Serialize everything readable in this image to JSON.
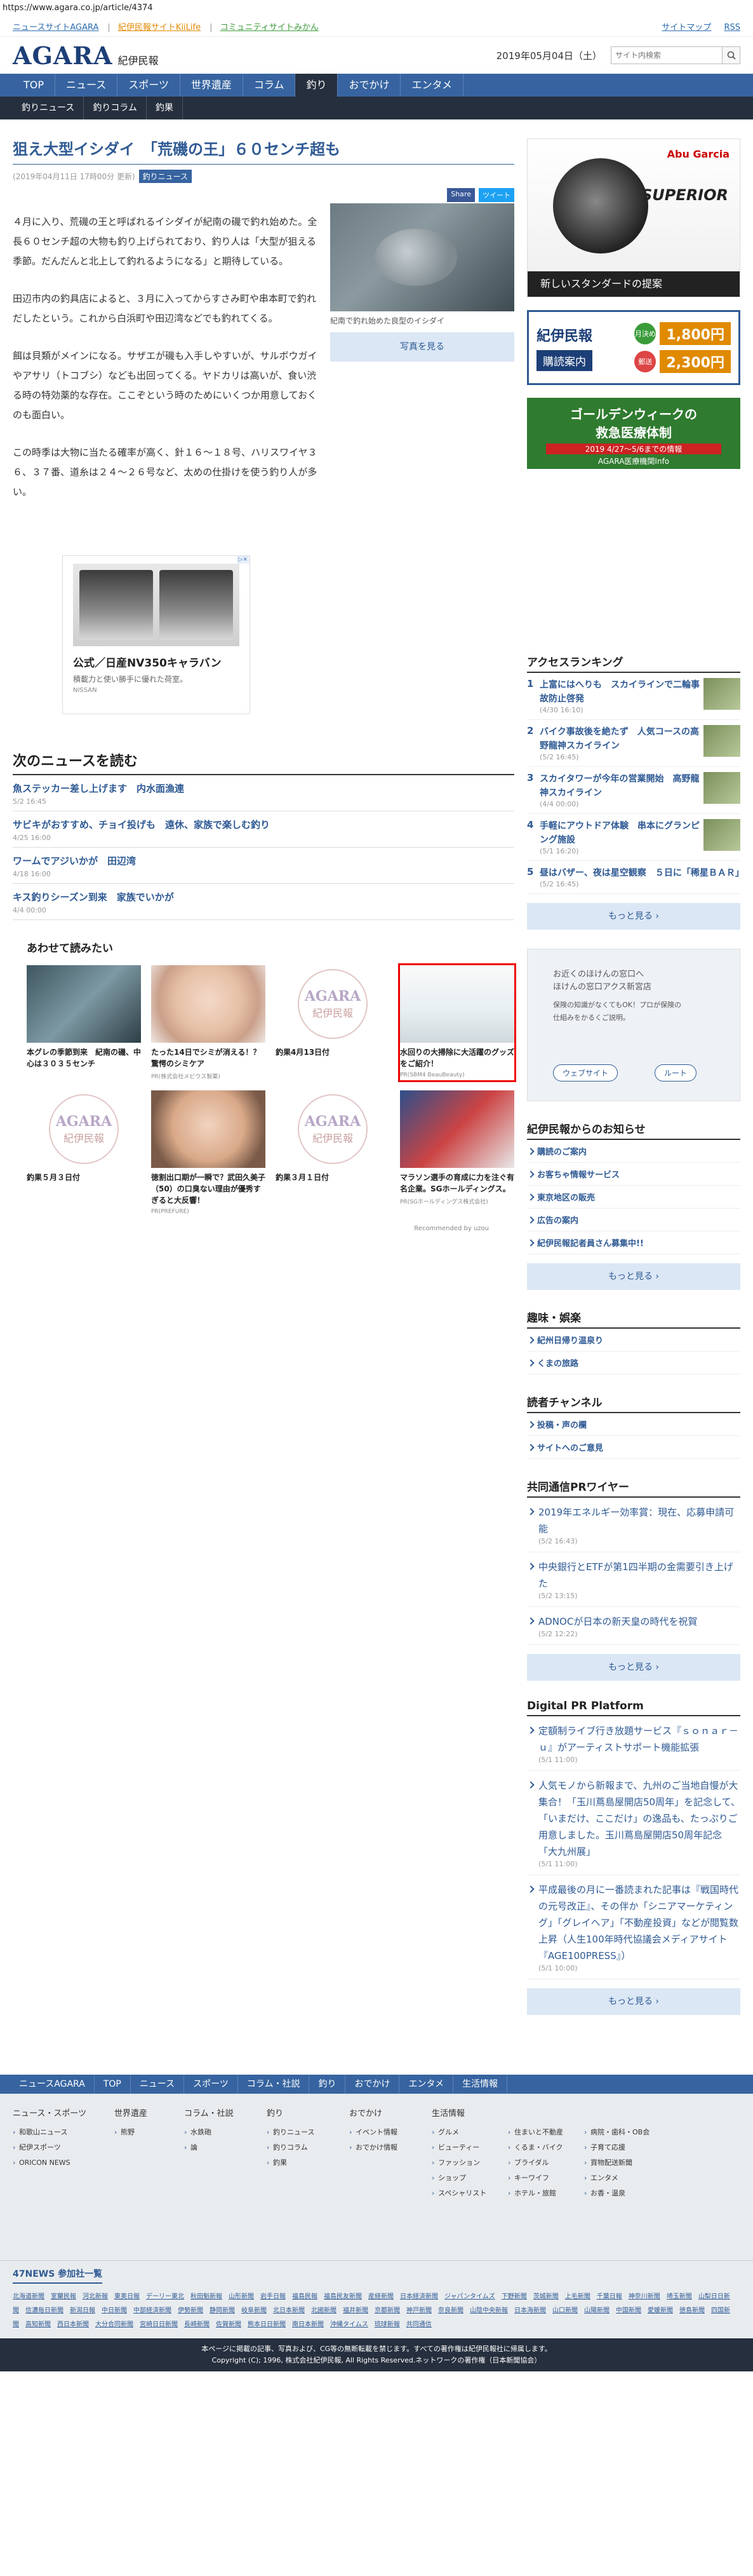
{
  "url": "https://www.agara.co.jp/article/4374",
  "toplinks": {
    "left": [
      "ニュースサイトAGARA",
      "紀伊民報サイトKiiLife",
      "コミュニティサイトみかん"
    ],
    "right": [
      "サイトマップ",
      "RSS"
    ]
  },
  "header": {
    "logo_en": "AGARA",
    "logo_jp": "紀伊民報",
    "date": "2019年05月04日（土）",
    "search_placeholder": "サイト内検索"
  },
  "nav": [
    "TOP",
    "ニュース",
    "スポーツ",
    "世界遺産",
    "コラム",
    "釣り",
    "おでかけ",
    "エンタメ"
  ],
  "nav_active": "釣り",
  "subnav": [
    "釣りニュース",
    "釣りコラム",
    "釣果"
  ],
  "article": {
    "title": "狙え大型イシダイ　「荒磯の王」６０センチ超も",
    "date": "2019年04月11日 17時00分",
    "updated": "更新",
    "category": "釣りニュース",
    "share_fb": "Share",
    "share_tw": "ツイート",
    "paragraphs": [
      "４月に入り、荒磯の王と呼ばれるイシダイが紀南の磯で釣れ始めた。全長６０センチ超の大物も釣り上げられており、釣り人は「大型が狙える季節。だんだんと北上して釣れるようになる」と期待している。",
      "田辺市内の釣具店によると、３月に入ってからすさみ町や串本町で釣れだしたという。これから白浜町や田辺湾などでも釣れてくる。",
      "餌は貝類がメインになる。サザエが磯も入手しやすいが、サルボウガイやアサリ（トコブシ）なども出回ってくる。ヤドカリは高いが、食い渋る時の特効薬的な存在。ここぞという時のためにいくつか用意しておくのも面白い。",
      "この時季は大物に当たる確率が高く、針１６～１８号、ハリスワイヤ３６、３７番、道糸は２４～２６号など、太めの仕掛けを使う釣り人が多い。"
    ],
    "photo_caption": "紀南で釣れ始めた良型のイシダイ",
    "photo_button": "写真を見る"
  },
  "ad": {
    "title": "公式／日産NV350キャラバン",
    "sub": "積載力と使い勝手に優れた荷室。",
    "brand": "NISSAN"
  },
  "next_news": {
    "heading": "次のニュースを読む",
    "items": [
      {
        "title": "魚ステッカー差し上げます　内水面漁連",
        "date": "5/2 16:45"
      },
      {
        "title": "サビキがおすすめ、チョイ投げも　遠休、家族で楽しむ釣り",
        "date": "4/25 16:00"
      },
      {
        "title": "ワームでアジいかが　田辺湾",
        "date": "4/18 16:00"
      },
      {
        "title": "キス釣りシーズン到来　家族でいかが",
        "date": "4/4 00:00"
      }
    ]
  },
  "recommended": {
    "heading": "あわせて読みたい",
    "items": [
      {
        "title": "本グレの季節到来　紀南の磯、中心は３０３５センチ",
        "source": ""
      },
      {
        "title": "たった14日でシミが消える！？驚愕のシミケア",
        "source": "PR(株式会社メビウス製薬)"
      },
      {
        "title": "釣果4月13日付",
        "source": ""
      },
      {
        "title": "水回りの大掃除に大活躍のグッズをご紹介！",
        "source": "PR(SBM4 BeauBeauty)"
      },
      {
        "title": "釣果５月３日付",
        "source": ""
      },
      {
        "title": "徳割出口期が一瞬で？武田久美子（50）の口臭ない理由が優秀すぎると大反響！",
        "source": "PR(PREFURE)"
      },
      {
        "title": "釣果３月１日付",
        "source": ""
      },
      {
        "title": "マラソン選手の育成に力を注ぐ有名企業。SGホールディングス。",
        "source": "PR(SGホールディングス株式会社)"
      }
    ],
    "recommended_by": "Recommended by uzou"
  },
  "sidebar": {
    "reel_brand": "Abu Garcia",
    "reel_name": "SUPERIOR",
    "reel_sub": "新しいスタンダードの提案",
    "subs_title": "紀伊民報",
    "subs_btn": "購読案内",
    "subs_price1_tag": "月決め",
    "subs_price1": "1,800円",
    "subs_price2_tag": "郵送",
    "subs_price2": "2,300円",
    "gw_line1": "ゴールデンウィークの",
    "gw_line2": "救急医療体制",
    "gw_line3": "2019 4/27～5/6までの情報",
    "gw_line4": "AGARA医療機関Info",
    "ranking_heading": "アクセスランキング",
    "ranking": [
      {
        "title": "上富にはへりも　スカイラインで二輪事故防止啓発",
        "date": "(4/30 16:10)"
      },
      {
        "title": "バイク事故後を絶たず　人気コースの高野龍神スカイライン",
        "date": "(5/2 16:45)"
      },
      {
        "title": "スカイタワーが今年の営業開始　高野龍神スカイライン",
        "date": "(4/4 00:00)"
      },
      {
        "title": "手軽にアウトドア体験　串本にグランピング施設",
        "date": "(5/1 16:20)"
      },
      {
        "title": "昼はバザー、夜は星空観察　５日に「稀星ＢＡＲ」",
        "date": "(5/2 16:45)"
      }
    ],
    "more": "もっと見る ›",
    "map_text1": "お近くのほけんの窓口へ",
    "map_text2": "ほけんの窓口アクス新宮店",
    "map_text3": "保険の知識がなくてもOK！プロが保険の",
    "map_text4": "仕組みをかるくご説明。",
    "map_btn1": "ウェブサイト",
    "map_btn2": "ルート",
    "notice_heading": "紀伊民報からのお知らせ",
    "notices": [
      "購読のご案内",
      "お客ちゃ情報サービス",
      "東京地区の販売",
      "広告の案内",
      "紀伊民報記者員さん募集中!!"
    ],
    "hobby_heading": "趣味・娯楽",
    "hobbies": [
      "紀州日帰り温泉り",
      "くまの旅路"
    ],
    "reader_heading": "読者チャンネル",
    "readers": [
      "投稿・声の欄",
      "サイトへのご意見"
    ],
    "kyodo_heading": "共同通信PRワイヤー",
    "kyodo": [
      {
        "title": "2019年エネルギー効率賞：現在、応募申請可能",
        "date": "(5/2 16:43)"
      },
      {
        "title": "中央銀行とETFが第1四半期の金需要引き上げた",
        "date": "(5/2 13:15)"
      },
      {
        "title": "ADNOCが日本の新天皇の時代を祝賀",
        "date": "(5/2 12:22)"
      }
    ],
    "digital_heading": "Digital PR Platform",
    "digital": [
      {
        "title": "定額制ライブ行き放題サービス『ｓｏｎａｒ－ｕ』がアーティストサポート機能拡張",
        "date": "(5/1 11:00)"
      },
      {
        "title": "人気モノから新報まで、九州のご当地自慢が大集合！「玉川蔦島屋開店50周年」を記念して、「いまだけ、ここだけ」の逸品も、たっぷりご用意しました。玉川蔦島屋開店50周年記念「大九州展」",
        "date": "(5/1 11:00)"
      },
      {
        "title": "平成最後の月に一番読まれた記事は『戦国時代の元号改正』、その伴か「シニアマーケティング」「グレイヘア」「不動産投資」などが閲覧数上昇（人生100年時代協議会メディアサイト『AGE100PRESS』）",
        "date": "(5/1 10:00)"
      }
    ]
  },
  "footer": {
    "nav": [
      "ニュースAGARA",
      "TOP",
      "ニュース",
      "スポーツ",
      "コラム・社説",
      "釣り",
      "おでかけ",
      "エンタメ",
      "生活情報"
    ],
    "cols": [
      {
        "h": "ニュース・スポーツ",
        "items": [
          "和歌山ニュース",
          "紀伊スポーツ",
          "ORICON NEWS"
        ]
      },
      {
        "h": "世界遺産",
        "items": [
          "熊野"
        ]
      },
      {
        "h": "コラム・社説",
        "items": [
          "水鉄砲",
          "論"
        ]
      },
      {
        "h": "釣り",
        "items": [
          "釣りニュース",
          "釣りコラム",
          "釣果"
        ]
      },
      {
        "h": "おでかけ",
        "items": [
          "イベント情報",
          "おでかけ情報"
        ]
      },
      {
        "h": "生活情報",
        "items": [
          "グルメ",
          "住まいと不動産",
          "病院・歯科・OB会",
          "ビューティー",
          "くるま・バイク",
          "子育て応援",
          "ファッション",
          "ブライダル",
          "買物配送新聞",
          "ショップ",
          "キーワイフ",
          "エンタメ",
          "スペシャリスト",
          "ホテル・旅館",
          "お香・温泉"
        ]
      }
    ],
    "b47_heading": "47NEWS 参加社一覧",
    "b47_list": [
      "北海道新聞",
      "室蘭民報",
      "河北新報",
      "東奥日報",
      "デーリー東北",
      "秋田魁新報",
      "山形新聞",
      "岩手日報",
      "福島民報",
      "福島民友新聞",
      "産経新聞",
      "日本経済新聞",
      "ジャパンタイムズ",
      "下野新聞",
      "茨城新聞",
      "上毛新聞",
      "千葉日報",
      "神奈川新聞",
      "埼玉新聞",
      "山梨日日新聞",
      "信濃毎日新聞",
      "新潟日報",
      "中日新聞",
      "中部経済新聞",
      "伊勢新聞",
      "静岡新聞",
      "岐阜新聞",
      "北日本新聞",
      "北國新聞",
      "福井新聞",
      "京都新聞",
      "神戸新聞",
      "奈良新聞",
      "山陰中央新報",
      "日本海新聞",
      "山口新聞",
      "山陽新聞",
      "中国新聞",
      "愛媛新聞",
      "徳島新聞",
      "四国新聞",
      "高知新聞",
      "西日本新聞",
      "大分合同新聞",
      "宮崎日日新聞",
      "長崎新聞",
      "佐賀新聞",
      "熊本日日新聞",
      "南日本新聞",
      "沖縄タイムス",
      "琉球新報",
      "共同通信"
    ],
    "copy1": "本ページに掲載の記事、写真および、CG等の無断転載を禁じます。すべての著作権は紀伊民報社に帰属します。",
    "copy2": "Copyright (C); 1996, 株式会社紀伊民報, All Rights Reserved.ネットワークの著作権（日本新聞協会）"
  }
}
